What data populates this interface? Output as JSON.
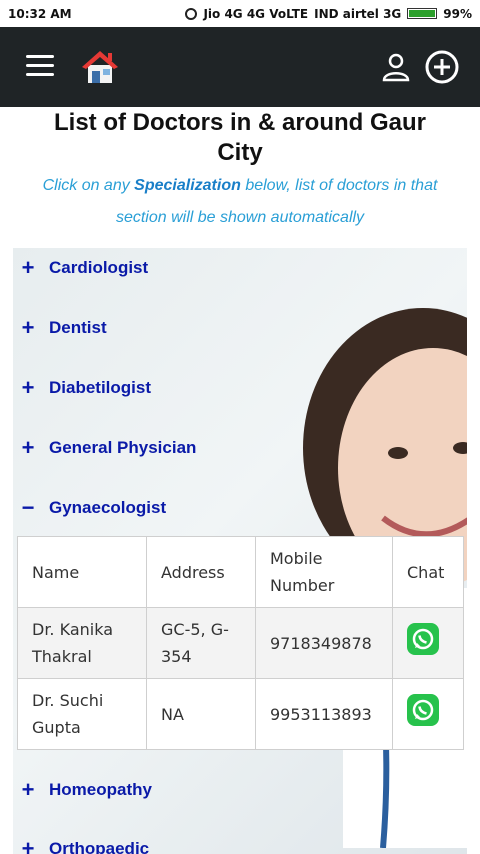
{
  "statusbar": {
    "time": "10:32 AM",
    "carriers": "Jio 4G 4G VoLTE",
    "carrier2": "IND airtel 3G",
    "battery": "99%",
    "battery_level": 0.99
  },
  "appbar": {
    "menu_icon": "hamburger-menu-icon",
    "home_icon": "home-icon",
    "user_icon": "user-icon",
    "add_icon": "add-circle-icon"
  },
  "page": {
    "title": "List of Doctors in & around Gaur City",
    "subtitle_prefix": "Click on any ",
    "subtitle_highlight": "Specialization",
    "subtitle_suffix": " below, list of doctors in that section will be shown automatically"
  },
  "categories": [
    {
      "label": "Cardiologist",
      "sign": "+",
      "expanded": false
    },
    {
      "label": "Dentist",
      "sign": "+",
      "expanded": false
    },
    {
      "label": "Diabetilogist",
      "sign": "+",
      "expanded": false
    },
    {
      "label": "General Physician",
      "sign": "+",
      "expanded": false
    },
    {
      "label": "Gynaecologist",
      "sign": "−",
      "expanded": true
    },
    {
      "label": "Homeopathy",
      "sign": "+",
      "expanded": false
    },
    {
      "label": "Orthopaedic",
      "sign": "+",
      "expanded": false
    }
  ],
  "table": {
    "headers": {
      "name": "Name",
      "address": "Address",
      "mobile": "Mobile Number",
      "chat": "Chat"
    },
    "rows": [
      {
        "name": "Dr. Kanika Thakral",
        "address": "GC-5, G-354",
        "mobile": "9718349878",
        "chat_icon": "whatsapp-icon"
      },
      {
        "name": "Dr. Suchi Gupta",
        "address": "NA",
        "mobile": "9953113893",
        "chat_icon": "whatsapp-icon"
      }
    ]
  },
  "colors": {
    "appbar": "#1f2426",
    "category_text": "#0a1aa8",
    "subtitle": "#2a9fd6",
    "whatsapp": "#27c24c"
  }
}
